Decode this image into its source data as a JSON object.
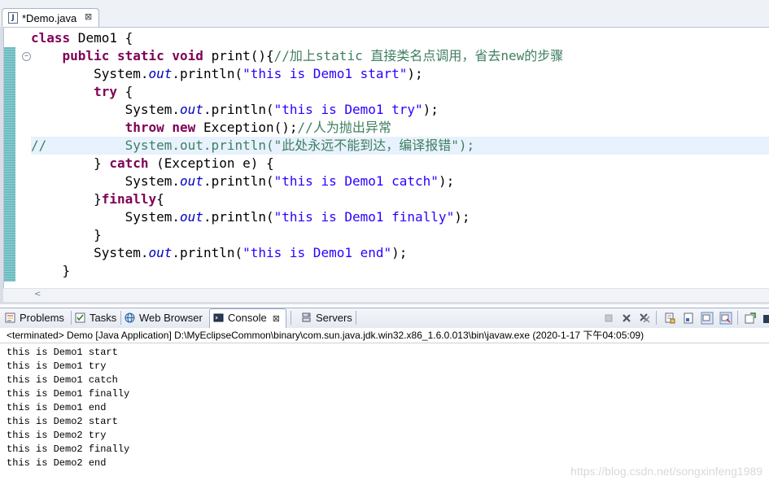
{
  "editor": {
    "tab_title": "*Demo.java",
    "file_icon_glyph": "J",
    "close_glyph": "⊠",
    "fold_glyph": "−",
    "scroll_left_glyph": "<",
    "code_lines": [
      [
        {
          "t": "kw",
          "v": "class"
        },
        {
          "t": "p",
          "v": " Demo1 {"
        }
      ],
      [
        {
          "t": "p",
          "v": "    "
        },
        {
          "t": "kw",
          "v": "public"
        },
        {
          "t": "p",
          "v": " "
        },
        {
          "t": "kw",
          "v": "static"
        },
        {
          "t": "p",
          "v": " "
        },
        {
          "t": "kw",
          "v": "void"
        },
        {
          "t": "p",
          "v": " print(){"
        },
        {
          "t": "cmt",
          "v": "//加上static 直接类名点调用，省去new的步骤"
        }
      ],
      [
        {
          "t": "p",
          "v": "        System."
        },
        {
          "t": "fld",
          "v": "out"
        },
        {
          "t": "p",
          "v": ".println("
        },
        {
          "t": "str",
          "v": "\"this is Demo1 start\""
        },
        {
          "t": "p",
          "v": ");"
        }
      ],
      [
        {
          "t": "p",
          "v": "        "
        },
        {
          "t": "kw",
          "v": "try"
        },
        {
          "t": "p",
          "v": " {"
        }
      ],
      [
        {
          "t": "p",
          "v": "            System."
        },
        {
          "t": "fld",
          "v": "out"
        },
        {
          "t": "p",
          "v": ".println("
        },
        {
          "t": "str",
          "v": "\"this is Demo1 try\""
        },
        {
          "t": "p",
          "v": ");"
        }
      ],
      [
        {
          "t": "p",
          "v": "            "
        },
        {
          "t": "kw",
          "v": "throw"
        },
        {
          "t": "p",
          "v": " "
        },
        {
          "t": "kw",
          "v": "new"
        },
        {
          "t": "p",
          "v": " Exception();"
        },
        {
          "t": "cmt",
          "v": "//人为抛出异常"
        }
      ],
      [
        {
          "t": "cmt",
          "v": "//          System.out.println(\"此处永远不能到达，编译报错\");"
        }
      ],
      [
        {
          "t": "p",
          "v": "        } "
        },
        {
          "t": "kw",
          "v": "catch"
        },
        {
          "t": "p",
          "v": " (Exception e) {"
        }
      ],
      [
        {
          "t": "p",
          "v": "            System."
        },
        {
          "t": "fld",
          "v": "out"
        },
        {
          "t": "p",
          "v": ".println("
        },
        {
          "t": "str",
          "v": "\"this is Demo1 catch\""
        },
        {
          "t": "p",
          "v": ");"
        }
      ],
      [
        {
          "t": "p",
          "v": "        }"
        },
        {
          "t": "kw",
          "v": "finally"
        },
        {
          "t": "p",
          "v": "{"
        }
      ],
      [
        {
          "t": "p",
          "v": "            System."
        },
        {
          "t": "fld",
          "v": "out"
        },
        {
          "t": "p",
          "v": ".println("
        },
        {
          "t": "str",
          "v": "\"this is Demo1 finally\""
        },
        {
          "t": "p",
          "v": ");"
        }
      ],
      [
        {
          "t": "p",
          "v": "        }"
        }
      ],
      [
        {
          "t": "p",
          "v": "        System."
        },
        {
          "t": "fld",
          "v": "out"
        },
        {
          "t": "p",
          "v": ".println("
        },
        {
          "t": "str",
          "v": "\"this is Demo1 end\""
        },
        {
          "t": "p",
          "v": ");"
        }
      ],
      [
        {
          "t": "p",
          "v": "    }"
        }
      ]
    ],
    "current_line_index": 6,
    "colors": {
      "keyword": "#7f0055",
      "string": "#2a00ff",
      "field": "#0000c0",
      "comment": "#3f7f5f",
      "current_line": "#e8f2fe",
      "change_ruler": "#6cbcc0"
    }
  },
  "views": {
    "tabs": [
      {
        "label": "Problems",
        "icon": "problems-icon"
      },
      {
        "label": "Tasks",
        "icon": "tasks-icon"
      },
      {
        "label": "Web Browser",
        "icon": "globe-icon"
      },
      {
        "label": "Console",
        "icon": "console-icon",
        "active": true
      },
      {
        "label": "Servers",
        "icon": "servers-icon"
      }
    ],
    "console_close_glyph": "⊠",
    "toolbar_icons": [
      "terminate-icon",
      "remove-launch-icon",
      "remove-all-terminated-icon",
      "scroll-lock-icon",
      "pin-console-icon",
      "show-on-output-icon",
      "show-on-error-icon",
      "display-selected-console-icon",
      "open-console-icon"
    ],
    "process_label": "<terminated> Demo [Java Application] D:\\MyEclipseCommon\\binary\\com.sun.java.jdk.win32.x86_1.6.0.013\\bin\\javaw.exe (2020-1-17 下午04:05:09)",
    "output_lines": [
      "this is Demo1 start",
      "this is Demo1 try",
      "this is Demo1 catch",
      "this is Demo1 finally",
      "this is Demo1 end",
      "this is Demo2 start",
      "this is Demo2 try",
      "this is Demo2 finally",
      "this is Demo2 end"
    ]
  },
  "watermark": "https://blog.csdn.net/songxinfeng1989"
}
